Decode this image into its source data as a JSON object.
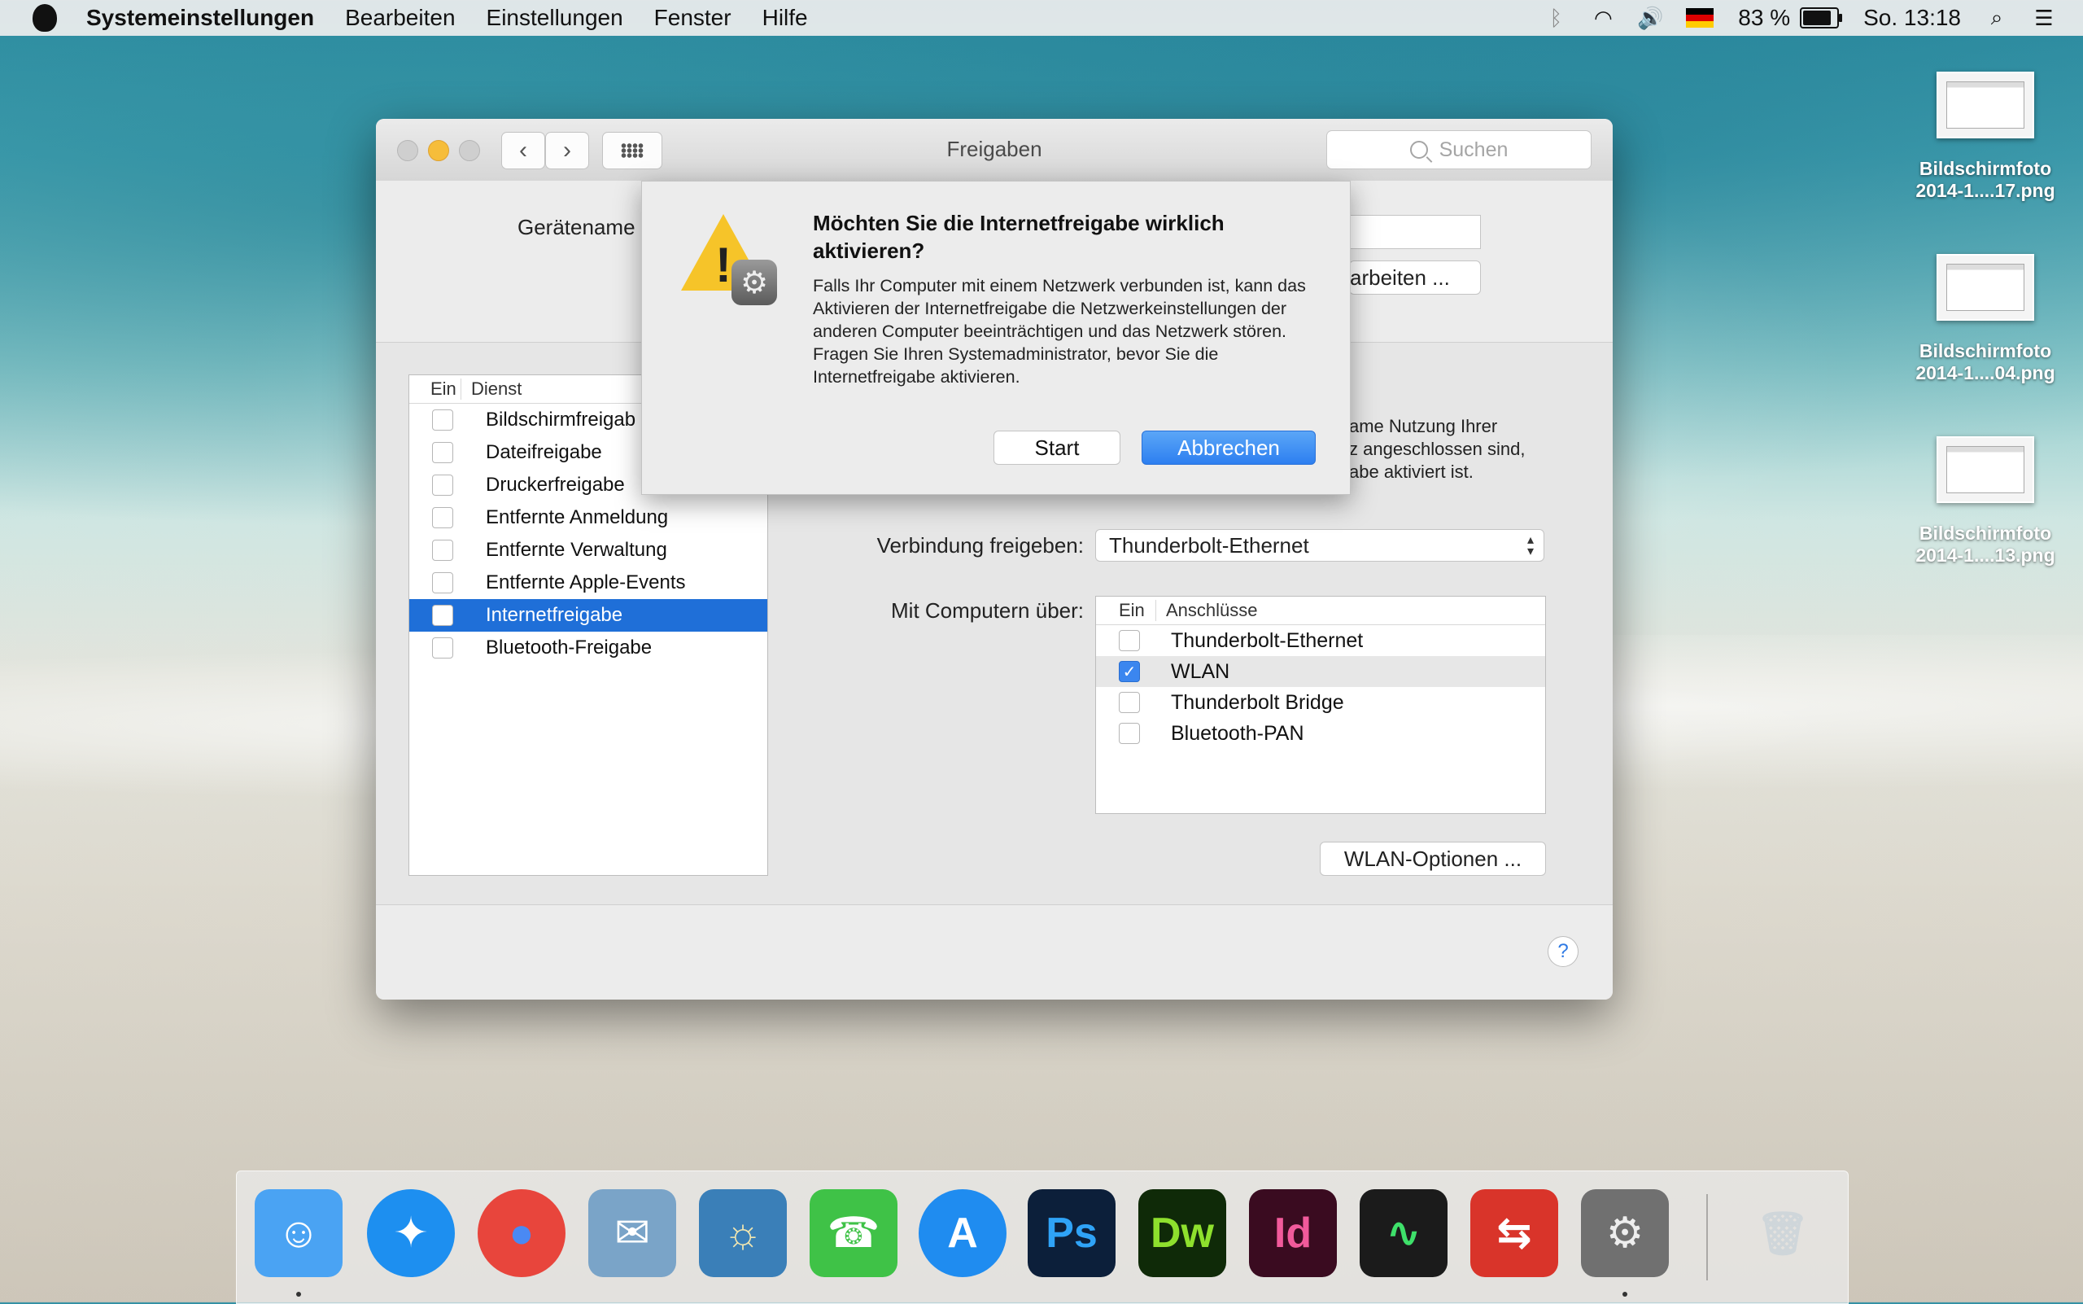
{
  "menubar": {
    "app_name": "Systemeinstellungen",
    "items": [
      "Bearbeiten",
      "Einstellungen",
      "Fenster",
      "Hilfe"
    ],
    "battery": "83 %",
    "clock": "So. 13:18",
    "icons": [
      "bluetooth-icon",
      "wifi-icon",
      "volume-icon",
      "german-flag-icon",
      "battery-icon",
      "spotlight-icon",
      "notification-center-icon"
    ]
  },
  "desktop": {
    "files": [
      {
        "line1": "Bildschirmfoto",
        "line2": "2014-1....17.png"
      },
      {
        "line1": "Bildschirmfoto",
        "line2": "2014-1....04.png"
      },
      {
        "line1": "Bildschirmfoto",
        "line2": "2014-1....13.png"
      }
    ]
  },
  "window": {
    "title": "Freigaben",
    "back": "‹",
    "forward": "›",
    "search_placeholder": "Suchen",
    "device_name_label": "Gerätename",
    "edit_button_partial": "arbeiten ...",
    "service_list": {
      "header_on": "Ein",
      "header_service": "Dienst",
      "items": [
        {
          "label": "Bildschirmfreigab",
          "checked": false
        },
        {
          "label": "Dateifreigabe",
          "checked": false
        },
        {
          "label": "Druckerfreigabe",
          "checked": false
        },
        {
          "label": "Entfernte Anmeldung",
          "checked": false
        },
        {
          "label": "Entfernte Verwaltung",
          "checked": false
        },
        {
          "label": "Entfernte Apple-Events",
          "checked": false
        },
        {
          "label": "Internetfreigabe",
          "checked": false,
          "selected": true
        },
        {
          "label": "Bluetooth-Freigabe",
          "checked": false
        }
      ]
    },
    "partial_desc": [
      "ame Nutzung Ihrer",
      "z angeschlossen sind,",
      "abe aktiviert ist."
    ],
    "share_connection_label": "Verbindung freigeben:",
    "share_connection_value": "Thunderbolt-Ethernet",
    "to_computers_label": "Mit Computern über:",
    "ports": {
      "header_on": "Ein",
      "header_ports": "Anschlüsse",
      "items": [
        {
          "label": "Thunderbolt-Ethernet",
          "checked": false
        },
        {
          "label": "WLAN",
          "checked": true
        },
        {
          "label": "Thunderbolt Bridge",
          "checked": false
        },
        {
          "label": "Bluetooth-PAN",
          "checked": false
        }
      ]
    },
    "wlan_options": "WLAN-Optionen ...",
    "help": "?"
  },
  "alert": {
    "title": "Möchten Sie die Internetfreigabe wirklich aktivieren?",
    "body": "Falls Ihr Computer mit einem Netzwerk verbunden ist, kann das Aktivieren der Internetfreigabe die Netzwerkeinstellungen der anderen Computer beeinträchtigen und das Netzwerk stören. Fragen Sie Ihren Systemadministrator, bevor Sie die Internetfreigabe aktivieren.",
    "start": "Start",
    "cancel": "Abbrechen"
  },
  "dock": {
    "apps": [
      {
        "name": "finder-icon",
        "glyph": "☺",
        "bg": "#4aa3f3",
        "fg": "#ffffff"
      },
      {
        "name": "safari-icon",
        "glyph": "✦",
        "bg": "#1d8ff0",
        "fg": "#ffffff"
      },
      {
        "name": "chrome-icon",
        "glyph": "●",
        "bg": "#e8453c",
        "fg": "#4a89f3"
      },
      {
        "name": "mail-icon",
        "glyph": "✉",
        "bg": "#7aa4c8",
        "fg": "#ffffff"
      },
      {
        "name": "iphoto-icon",
        "glyph": "☼",
        "bg": "#3a7fb8",
        "fg": "#f1e6b0"
      },
      {
        "name": "facetime-icon",
        "glyph": "☎",
        "bg": "#3fc247",
        "fg": "#ffffff"
      },
      {
        "name": "app-store-icon",
        "glyph": "A",
        "bg": "#1f8cf0",
        "fg": "#ffffff"
      },
      {
        "name": "photoshop-icon",
        "glyph": "Ps",
        "bg": "#0c1f3a",
        "fg": "#2fa3f7"
      },
      {
        "name": "dreamweaver-icon",
        "glyph": "Dw",
        "bg": "#0f2a08",
        "fg": "#8ee02d"
      },
      {
        "name": "indesign-icon",
        "glyph": "Id",
        "bg": "#3a0b20",
        "fg": "#f15a9b"
      },
      {
        "name": "activity-monitor-icon",
        "glyph": "∿",
        "bg": "#1b1b1b",
        "fg": "#3ee06a"
      },
      {
        "name": "remote-desktop-icon",
        "glyph": "⇆",
        "bg": "#d9342a",
        "fg": "#ffffff"
      },
      {
        "name": "system-preferences-icon",
        "glyph": "⚙",
        "bg": "#707070",
        "fg": "#eeeeee"
      },
      {
        "name": "trash-icon",
        "glyph": "🗑",
        "bg": "transparent",
        "fg": "#cfd6da"
      }
    ]
  }
}
